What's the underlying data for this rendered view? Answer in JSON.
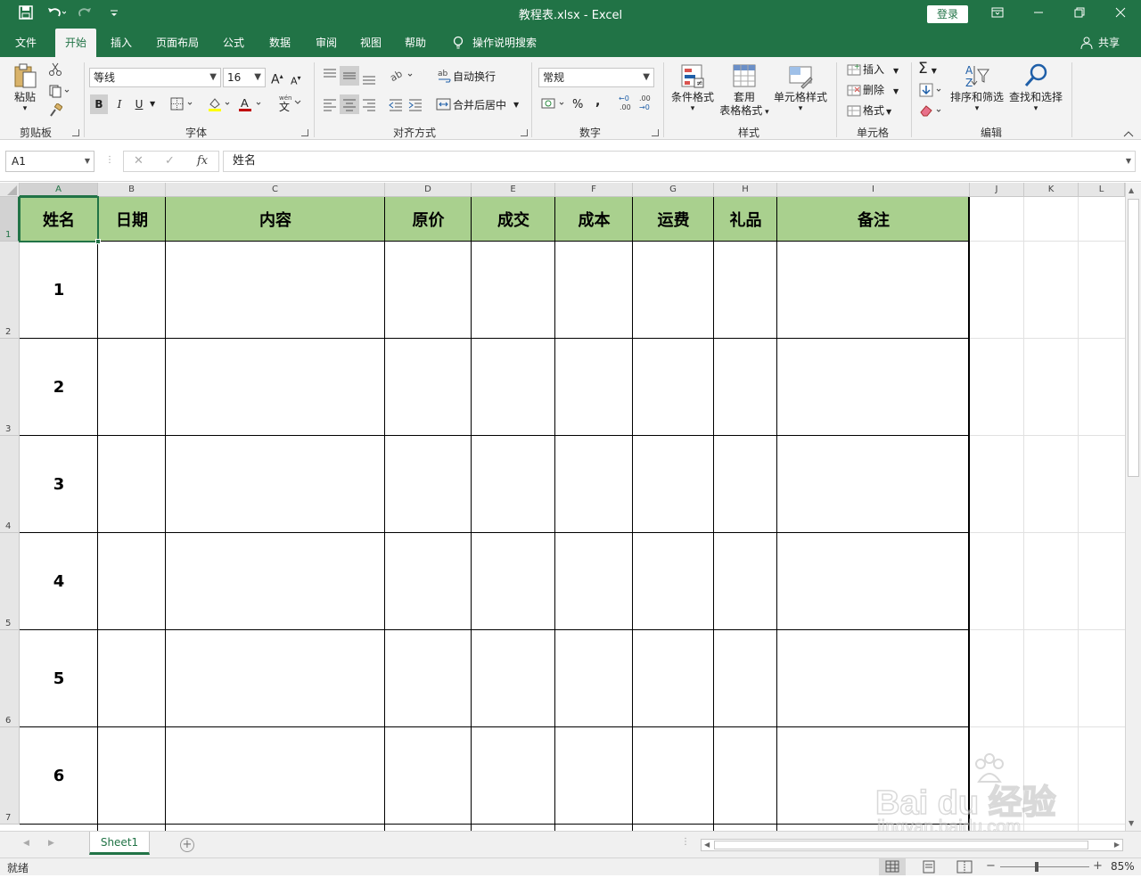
{
  "window": {
    "title": "教程表.xlsx  -  Excel",
    "login_label": "登录",
    "accent": "#217346"
  },
  "quick_access": {
    "save": "save-icon",
    "undo": "undo-icon",
    "redo": "redo-icon",
    "customize": "customize-icon"
  },
  "tabs": [
    "文件",
    "开始",
    "插入",
    "页面布局",
    "公式",
    "数据",
    "审阅",
    "视图",
    "帮助"
  ],
  "active_tab": "开始",
  "tell_me": "操作说明搜索",
  "share": "共享",
  "ribbon": {
    "clipboard": {
      "paste": "粘贴",
      "group": "剪贴板"
    },
    "font": {
      "name": "等线",
      "size": "16",
      "bold": "B",
      "italic": "I",
      "underline": "U",
      "grow": "A",
      "shrink": "A",
      "group": "字体",
      "wen": "文",
      "wen_top": "wén"
    },
    "alignment": {
      "wrap": "自动换行",
      "merge": "合并后居中",
      "group": "对齐方式",
      "ab": "ab"
    },
    "number": {
      "format": "常规",
      "percent": "%",
      "comma": ",",
      "inc_decimal": ".00",
      "dec_decimal": ".00",
      "group": "数字"
    },
    "styles": {
      "conditional": "条件格式",
      "table_line1": "套用",
      "table_line2": "表格格式",
      "cell_styles": "单元格样式",
      "group": "样式"
    },
    "cells": {
      "insert": "插入",
      "delete": "删除",
      "format": "格式",
      "group": "单元格"
    },
    "editing": {
      "sum": "Σ",
      "sort": "排序和筛选",
      "find": "查找和选择",
      "group": "编辑"
    }
  },
  "formula_bar": {
    "name_box": "A1",
    "cancel": "✕",
    "enter": "✓",
    "fx": "fx",
    "content": "姓名"
  },
  "columns": [
    "A",
    "B",
    "C",
    "D",
    "E",
    "F",
    "G",
    "H",
    "I",
    "J",
    "K",
    "L"
  ],
  "rows": [
    "1",
    "2",
    "3",
    "4",
    "5",
    "6",
    "7"
  ],
  "table": {
    "headers": [
      "姓名",
      "日期",
      "内容",
      "原价",
      "成交",
      "成本",
      "运费",
      "礼品",
      "备注"
    ],
    "row_values": [
      "1",
      "2",
      "3",
      "4",
      "5",
      "6"
    ],
    "header_fill": "#a9d08e"
  },
  "sheet_tabs": {
    "active": "Sheet1",
    "add": "+"
  },
  "status": {
    "ready": "就绪",
    "zoom": "85%",
    "minus": "−",
    "plus": "+"
  },
  "watermark": {
    "brand": "Bai du 经验",
    "url": "jingyan.baidu.com"
  }
}
